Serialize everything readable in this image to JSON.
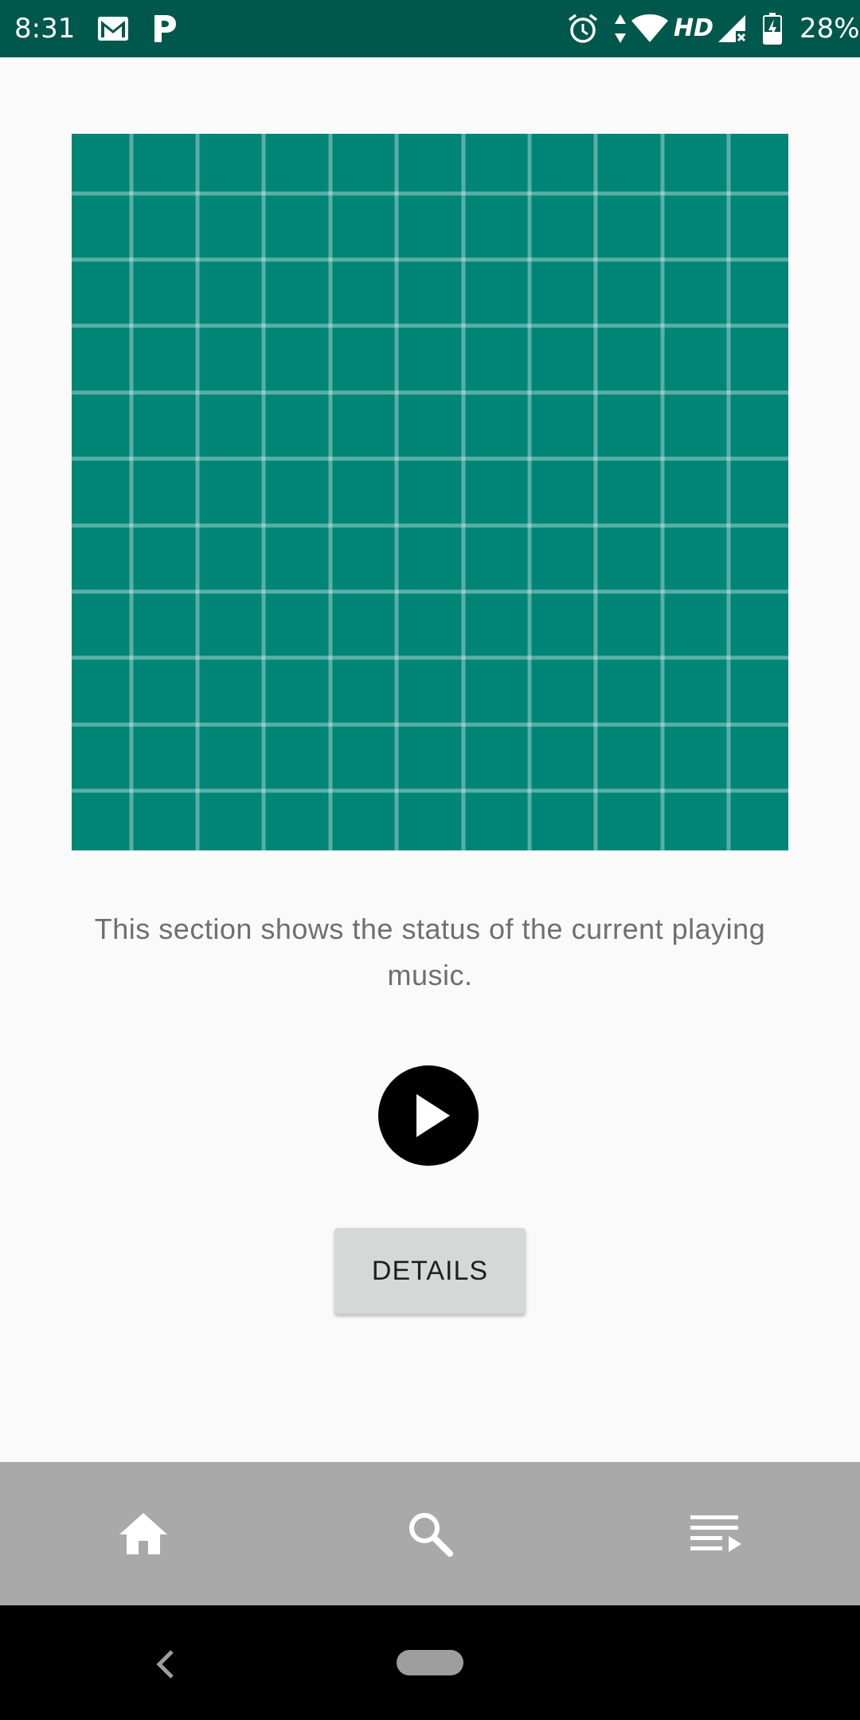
{
  "status_bar": {
    "time": "8:31",
    "network_label": "HD",
    "battery": "28%",
    "background_color": "#00574b",
    "icons": [
      "gmail-icon",
      "pandora-icon",
      "alarm-icon",
      "data-arrows-icon",
      "wifi-icon",
      "cell-signal-icon",
      "battery-icon"
    ]
  },
  "album_art": {
    "color": "#008577",
    "icon": "album-art-grid-placeholder"
  },
  "description": "This section shows the status of the current playing music.",
  "player": {
    "play_icon": "play-icon"
  },
  "details_button": {
    "label": "DETAILS"
  },
  "bottom_nav": {
    "background_color": "#a9a9a9",
    "items": [
      {
        "icon": "home-icon"
      },
      {
        "icon": "search-icon"
      },
      {
        "icon": "queue-music-icon"
      }
    ]
  },
  "system_nav": {
    "icons": [
      "back-icon",
      "home-pill-icon"
    ]
  }
}
